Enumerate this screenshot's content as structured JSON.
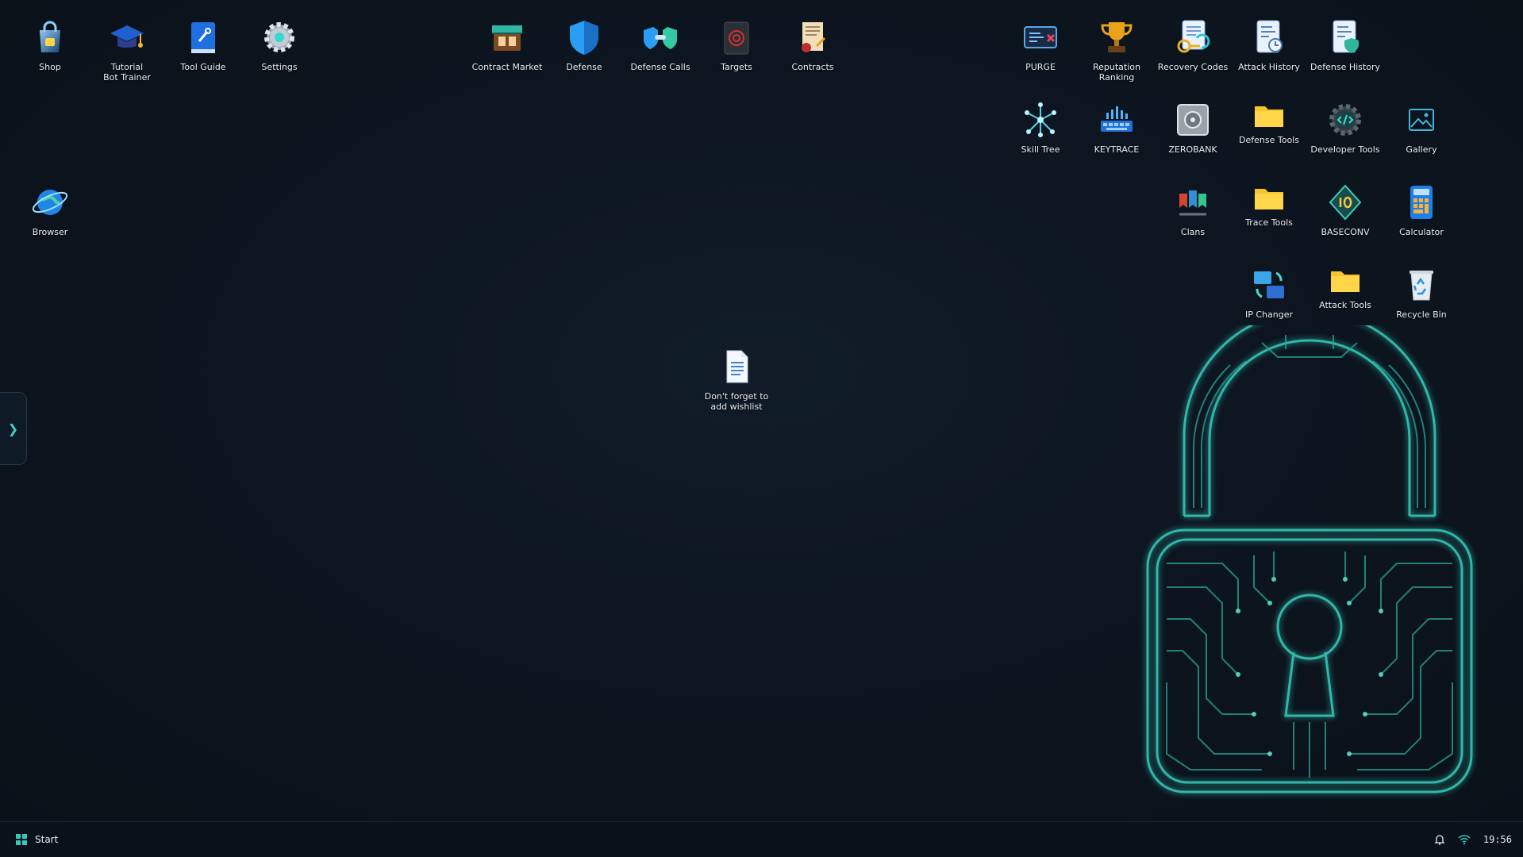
{
  "desktop": {
    "icons": [
      {
        "label": "Shop",
        "icon": "shop-bag-icon"
      },
      {
        "label": "Tutorial\nBot Trainer",
        "icon": "graduation-cap-icon"
      },
      {
        "label": "Tool Guide",
        "icon": "guide-book-icon"
      },
      {
        "label": "Settings",
        "icon": "gear-icon"
      },
      {
        "label": "Contract Market",
        "icon": "market-stall-icon"
      },
      {
        "label": "Defense",
        "icon": "shield-icon"
      },
      {
        "label": "Defense Calls",
        "icon": "shield-link-icon"
      },
      {
        "label": "Targets",
        "icon": "target-dossier-icon"
      },
      {
        "label": "Contracts",
        "icon": "scroll-contract-icon"
      },
      {
        "label": "PURGE",
        "icon": "purge-terminal-icon"
      },
      {
        "label": "Reputation\nRanking",
        "icon": "trophy-icon"
      },
      {
        "label": "Recovery Codes",
        "icon": "recovery-key-icon"
      },
      {
        "label": "Attack History",
        "icon": "attack-log-icon"
      },
      {
        "label": "Defense History",
        "icon": "defense-log-icon"
      },
      {
        "label": "Skill Tree",
        "icon": "skill-tree-icon"
      },
      {
        "label": "KEYTRACE",
        "icon": "keyboard-icon"
      },
      {
        "label": "ZEROBANK",
        "icon": "safe-icon"
      },
      {
        "label": "Defense Tools",
        "icon": "folder-icon"
      },
      {
        "label": "Developer Tools",
        "icon": "code-gear-icon"
      },
      {
        "label": "Gallery",
        "icon": "image-icon"
      },
      {
        "label": "Browser",
        "icon": "globe-icon"
      },
      {
        "label": "Clans",
        "icon": "clan-banners-icon"
      },
      {
        "label": "Trace Tools",
        "icon": "folder-icon"
      },
      {
        "label": "BASECONV",
        "icon": "binary-gem-icon"
      },
      {
        "label": "Calculator",
        "icon": "calculator-icon"
      },
      {
        "label": "IP Changer",
        "icon": "ip-swap-icon"
      },
      {
        "label": "Attack Tools",
        "icon": "folder-icon"
      },
      {
        "label": "Recycle Bin",
        "icon": "recycle-bin-icon"
      },
      {
        "label": "Don't forget to\nadd wishlist",
        "icon": "text-file-icon"
      }
    ],
    "wallpaper_icon": "circuit-padlock-icon",
    "side_toggle_icon": "chevron-right-icon"
  },
  "taskbar": {
    "start_label": "Start",
    "start_icon": "start-grid-icon",
    "notification_icon": "bell-icon",
    "wifi_icon": "wifi-icon",
    "clock": "19:56"
  },
  "colors": {
    "accent": "#3fd0c8",
    "background": "#0d1520",
    "folder": "#f7c42b"
  }
}
